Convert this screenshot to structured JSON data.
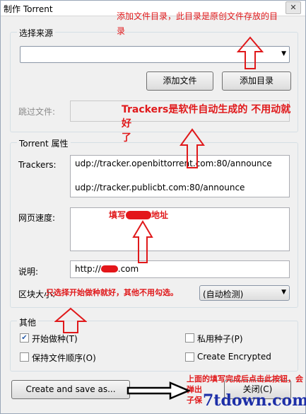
{
  "window": {
    "title": "制作 Torrent",
    "close_label": "✕"
  },
  "source": {
    "group_title": "选择来源",
    "combo_value": "",
    "add_file_button": "添加文件",
    "add_dir_button": "添加目录",
    "skip_label": "跳过文件:"
  },
  "properties": {
    "group_title": "Torrent 属性",
    "trackers_label": "Trackers:",
    "trackers": [
      "udp://tracker.openbittorrent.com:80/announce",
      "udp://tracker.publicbt.com:80/announce"
    ],
    "webseed_label": "网页速度:",
    "comment_label": "说明:",
    "comment_value": "http://",
    "comment_value_suffix": ".com",
    "piece_size_label": "区块大小:",
    "piece_size_value": "(自动检测)"
  },
  "other": {
    "group_title": "其他",
    "start_seeding": {
      "label": "开始做种(T)",
      "checked": true
    },
    "private_torrent": {
      "label": "私用种子(P)",
      "checked": false
    },
    "preserve_order": {
      "label": "保持文件顺序(O)",
      "checked": false
    },
    "create_encrypted": {
      "label": "Create Encrypted",
      "checked": false
    }
  },
  "footer": {
    "create_button": "Create and save as...",
    "close_button": "关闭(C)"
  },
  "annotations": {
    "top_note_line1": "添加文件目录，此目录是原创文件存放的目",
    "top_note_line2": "录",
    "trackers_note_line1": "Trackers是软件自动生成的 不用动就好",
    "trackers_note_line2": "了",
    "webseed_note_prefix": "填写",
    "webseed_note_suffix": "地址",
    "seeding_note": "只选择开始做种就好，其他不用勾选。",
    "bottom_note_line1": "上面的填写完成后点击此按钮，会",
    "bottom_note_line2": "弹出",
    "bottom_note_line3": "子保"
  },
  "watermark": "7tdown.com",
  "colors": {
    "annotation": "#e0191b",
    "watermark": "#1d2fa8"
  }
}
